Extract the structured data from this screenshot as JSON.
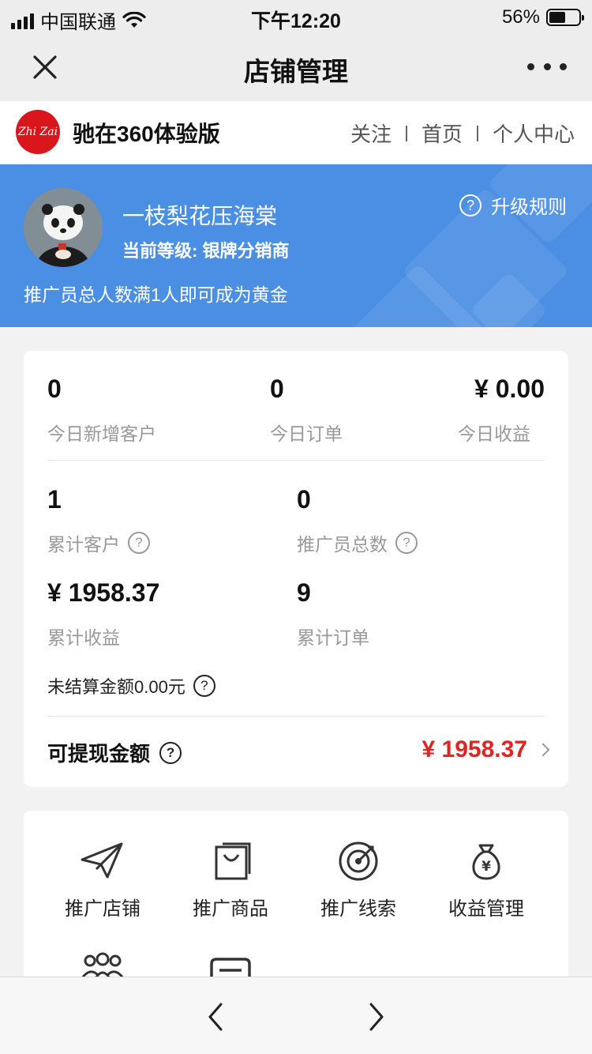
{
  "status_bar": {
    "carrier": "中国联通",
    "time": "下午12:20",
    "battery": "56%",
    "battery_level": 0.56
  },
  "nav": {
    "title": "店铺管理"
  },
  "shop": {
    "logo_text": "Zhi Zai",
    "name": "驰在360体验版",
    "links": [
      "关注",
      "首页",
      "个人中心"
    ]
  },
  "profile": {
    "name": "一枝梨花压海棠",
    "level": "当前等级: 银牌分销商",
    "upgrade_label": "升级规则",
    "tip": "推广员总人数满1人即可成为黄金"
  },
  "stats": {
    "today": [
      {
        "value": "0",
        "label": "今日新增客户"
      },
      {
        "value": "0",
        "label": "今日订单"
      },
      {
        "value": "¥ 0.00",
        "label": "今日收益"
      }
    ],
    "totals": [
      {
        "value": "1",
        "label": "累计客户"
      },
      {
        "value": "0",
        "label": "推广员总数"
      },
      {
        "value": "¥ 1958.37",
        "label": "累计收益"
      },
      {
        "value": "9",
        "label": "累计订单"
      }
    ],
    "unsettled": "未结算金额0.00元",
    "withdraw_label": "可提现金额",
    "withdraw_amount": "¥ 1958.37"
  },
  "menu": [
    {
      "icon": "send-icon",
      "label": "推广店铺"
    },
    {
      "icon": "shopping-bag-icon",
      "label": "推广商品"
    },
    {
      "icon": "target-icon",
      "label": "推广线索"
    },
    {
      "icon": "money-bag-icon",
      "label": "收益管理"
    }
  ],
  "colors": {
    "accent_blue": "#4a8fe3",
    "amount_red": "#e02424",
    "brand_red": "#d8161b"
  }
}
